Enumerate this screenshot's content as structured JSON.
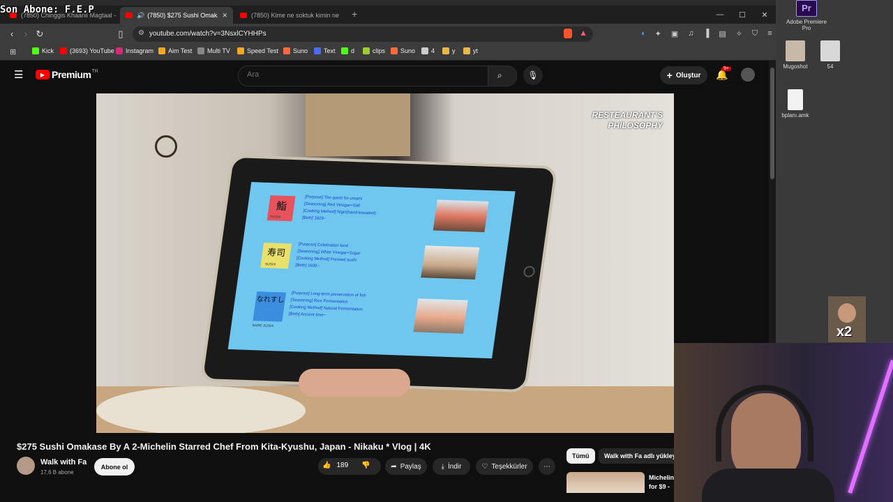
{
  "overlay_text": "Son Abone: F.E.P",
  "browser": {
    "tabs": [
      {
        "label": "(7850) Chinggis Khaanii Magtaal - Ba"
      },
      {
        "label": "(7850) $275 Sushi Omakase B",
        "active": true
      },
      {
        "label": "(7850) Kime ne soktuk kimin ne kuyr"
      }
    ],
    "new_tab": "+",
    "url": "youtube.com/watch?v=3NsxlCYHHPs",
    "bookmarks": [
      {
        "label": "Kick",
        "color": "#53fc18"
      },
      {
        "label": "(3693) YouTube",
        "color": "#ff0000"
      },
      {
        "label": "Instagram",
        "color": "#d62976"
      },
      {
        "label": "Aim Test",
        "color": "#f5a623"
      },
      {
        "label": "Multi TV",
        "color": "#888888"
      },
      {
        "label": "Speed Test",
        "color": "#f5a623"
      },
      {
        "label": "Suno",
        "color": "#ff6a3d"
      },
      {
        "label": "Text",
        "color": "#4a6cf7"
      },
      {
        "label": "d",
        "color": "#53fc18"
      },
      {
        "label": "clips",
        "color": "#9acd32"
      },
      {
        "label": "Suno",
        "color": "#ff6a3d"
      },
      {
        "label": "4",
        "color": "#cccccc"
      },
      {
        "label": "y",
        "color": "#e8b84a"
      },
      {
        "label": "yt",
        "color": "#e8b84a"
      }
    ]
  },
  "youtube": {
    "logo_text": "Premium",
    "region": "TR",
    "search_placeholder": "Ara",
    "create_label": "Oluştur",
    "notif_badge": "9+",
    "video": {
      "overlay_line1": "RESTEAURANT'S",
      "overlay_line2": "PHILOSOPHY",
      "tablet": [
        {
          "kanji": "鮨",
          "sub": "SUSHI",
          "lines": [
            "[Purpose]  The quest for umami",
            "[Seasoning]  Red Vinegar+Salt",
            "[Cooking Method]  Nigiri(hand-kneaded)",
            "[Birth]  1829~"
          ]
        },
        {
          "kanji": "寿司",
          "sub": "SUSHI",
          "lines": [
            "[Purpose]  Celebration food",
            "[Seasoning]  White Vinegar+Sugar",
            "[Cooking Method]  Pressed sushi",
            "[Birth]  1600~"
          ]
        },
        {
          "kanji": "なれすし",
          "sub": "NARE-SUSHI",
          "lines": [
            "[Purpose]  Long-term preservation of fish",
            "[Seasoning]  Rice Fermentation",
            "[Cooking Method]  Natural Fermentation",
            "[Birth]  Ancient time~"
          ]
        }
      ]
    },
    "title": "$275 Sushi Omakase By A 2-Michelin Starred Chef From Kita-Kyushu, Japan - Nikaku * Vlog | 4K",
    "channel_name": "Walk with Fa",
    "subscribers": "17,6 B abone",
    "subscribe_label": "Abone ol",
    "likes": "189",
    "share_label": "Paylaş",
    "download_label": "İndir",
    "thanks_label": "Teşekkürler",
    "more_label": "⋯",
    "filter_all": "Tümü",
    "filter_channel": "Walk with Fa adlı yükley",
    "rec_title": "Michelin",
    "rec_title2": "for $9 -"
  },
  "desktop": {
    "icons": [
      {
        "label": "Adobe Premiere Pro"
      },
      {
        "label": "Mugoshot"
      },
      {
        "label": "54"
      },
      {
        "label": "bplanı.amk"
      }
    ],
    "sticker_label": "x2"
  }
}
